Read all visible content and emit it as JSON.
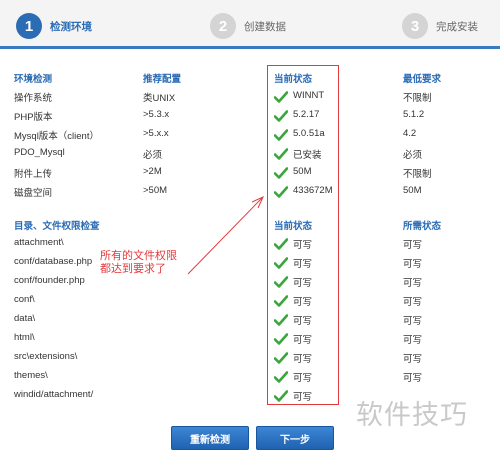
{
  "steps": [
    {
      "num": "1",
      "label": "检测环境"
    },
    {
      "num": "2",
      "label": "创建数据"
    },
    {
      "num": "3",
      "label": "完成安装"
    }
  ],
  "env": {
    "headers": [
      "环境检测",
      "推荐配置",
      "当前状态",
      "最低要求"
    ],
    "rows": [
      {
        "name": "操作系统",
        "recommended": "类UNIX",
        "current": "WINNT",
        "minimum": "不限制"
      },
      {
        "name": "PHP版本",
        "recommended": ">5.3.x",
        "current": "5.2.17",
        "minimum": "5.1.2"
      },
      {
        "name": "Mysql版本（client）",
        "recommended": ">5.x.x",
        "current": "5.0.51a",
        "minimum": "4.2"
      },
      {
        "name": "PDO_Mysql",
        "recommended": "必须",
        "current": "已安装",
        "minimum": "必须"
      },
      {
        "name": "附件上传",
        "recommended": ">2M",
        "current": "50M",
        "minimum": "不限制"
      },
      {
        "name": "磁盘空间",
        "recommended": ">50M",
        "current": "433672M",
        "minimum": "50M"
      }
    ]
  },
  "perm": {
    "headers": [
      "目录、文件权限检查",
      "当前状态",
      "所需状态"
    ],
    "rows": [
      {
        "path": "attachment\\",
        "current": "可写",
        "required": "可写"
      },
      {
        "path": "conf/database.php",
        "current": "可写",
        "required": "可写"
      },
      {
        "path": "conf/founder.php",
        "current": "可写",
        "required": "可写"
      },
      {
        "path": "conf\\",
        "current": "可写",
        "required": "可写"
      },
      {
        "path": "data\\",
        "current": "可写",
        "required": "可写"
      },
      {
        "path": "html\\",
        "current": "可写",
        "required": "可写"
      },
      {
        "path": "src\\extensions\\",
        "current": "可写",
        "required": "可写"
      },
      {
        "path": "themes\\",
        "current": "可写",
        "required": "可写"
      },
      {
        "path": "windid/attachment/",
        "current": "可写",
        "required": ""
      }
    ]
  },
  "annotation": {
    "line1": "所有的文件权限",
    "line2": "都达到要求了"
  },
  "buttons": {
    "recheck": "重新检测",
    "next": "下一步"
  },
  "watermark": "软件技巧",
  "colors": {
    "accent": "#2b6cb5",
    "check": "#3aa53a",
    "annotation": "#e4393c"
  }
}
